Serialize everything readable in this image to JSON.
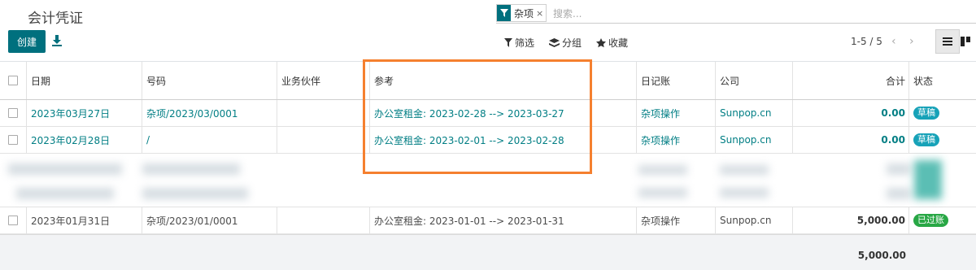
{
  "header": {
    "title": "会计凭证",
    "create_label": "创建",
    "search": {
      "facet_label": "杂项",
      "facet_remove": "×",
      "placeholder": "搜索..."
    },
    "filters": [
      {
        "label": "筛选",
        "icon": "funnel-icon"
      },
      {
        "label": "分组",
        "icon": "layers-icon"
      },
      {
        "label": "收藏",
        "icon": "star-icon"
      }
    ],
    "pager": "1-5 / 5"
  },
  "columns": {
    "date": "日期",
    "number": "号码",
    "partner": "业务伙伴",
    "ref": "参考",
    "journal": "日记账",
    "company": "公司",
    "total": "合计",
    "state": "状态"
  },
  "rows": [
    {
      "date": "2023年03月27日",
      "number": "杂项/2023/03/0001",
      "partner": "",
      "ref": "办公室租金: 2023-02-28 --> 2023-03-27",
      "journal": "杂项操作",
      "company": "Sunpop.cn",
      "total": "0.00",
      "state": "草稿"
    },
    {
      "date": "2023年02月28日",
      "number": "/",
      "partner": "",
      "ref": "办公室租金: 2023-02-01 --> 2023-02-28",
      "journal": "杂项操作",
      "company": "Sunpop.cn",
      "total": "0.00",
      "state": "草稿"
    },
    {
      "date": "2023年01月31日",
      "number": "杂项/2023/01/0001",
      "partner": "",
      "ref": "办公室租金: 2023-01-01 --> 2023-01-31",
      "journal": "杂项操作",
      "company": "Sunpop.cn",
      "total": "5,000.00",
      "state": "已过账"
    }
  ],
  "footer_total": "5,000.00",
  "colors": {
    "primary": "#00707e",
    "link": "#017e84",
    "draft": "#17a2b8",
    "posted": "#28a745",
    "highlight": "#f5802f"
  }
}
